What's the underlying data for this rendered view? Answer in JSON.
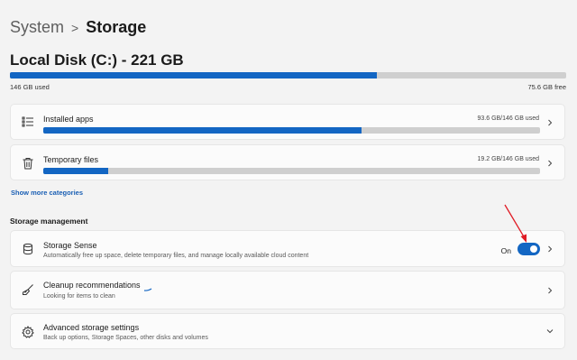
{
  "breadcrumb": {
    "parent": "System",
    "separator": ">",
    "current": "Storage"
  },
  "disk": {
    "title": "Local Disk (C:) - 221 GB",
    "used_label": "146 GB used",
    "free_label": "75.6 GB free",
    "used_fraction": 0.66
  },
  "categories": [
    {
      "label": "Installed apps",
      "value": "93.6 GB/146 GB used",
      "fraction": 0.64,
      "icon": "list-icon"
    },
    {
      "label": "Temporary files",
      "value": "19.2 GB/146 GB used",
      "fraction": 0.13,
      "icon": "trash-icon"
    }
  ],
  "show_more": "Show more categories",
  "management": {
    "title": "Storage management",
    "items": [
      {
        "title": "Storage Sense",
        "subtitle": "Automatically free up space, delete temporary files, and manage locally available cloud content",
        "toggle_label": "On",
        "icon": "database-icon"
      },
      {
        "title": "Cleanup recommendations",
        "subtitle": "Looking for items to clean",
        "icon": "broom-icon"
      },
      {
        "title": "Advanced storage settings",
        "subtitle": "Back up options, Storage Spaces, other disks and volumes",
        "icon": "gear-icon"
      }
    ]
  },
  "colors": {
    "accent": "#1366c3",
    "background": "#f3f3f3",
    "card": "#fbfbfb",
    "arrow": "#e01b24"
  }
}
